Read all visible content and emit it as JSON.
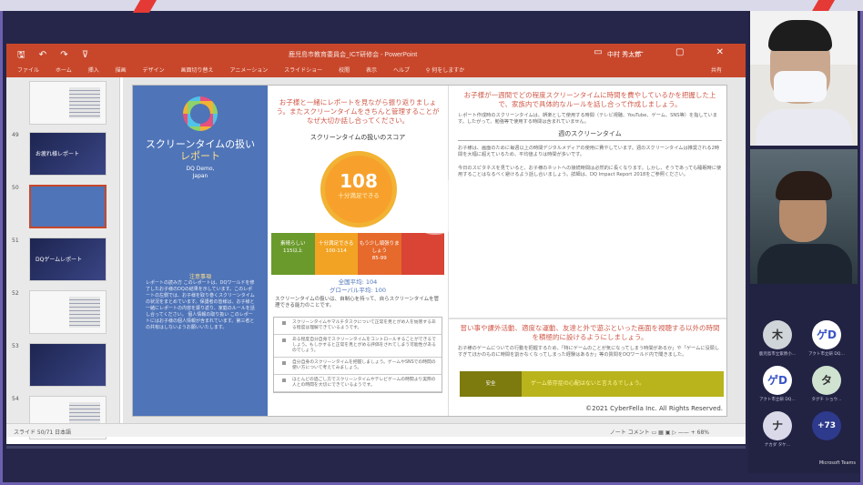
{
  "window": {
    "title": "鹿児島市教育委員会_ICT研修会 - PowerPoint",
    "user": "中村 秀太郎",
    "quick_access": "🖫 ↶ ↷ ⊽",
    "controls": "▭ — ▢ ✕",
    "ribbon_tabs": [
      "ファイル",
      "ホーム",
      "挿入",
      "描画",
      "デザイン",
      "画面切り替え",
      "アニメーション",
      "スライドショー",
      "校閲",
      "表示",
      "ヘルプ"
    ],
    "tell_me": "何をしますか",
    "share": "共有"
  },
  "thumbnails": [
    {
      "num": "",
      "label": ""
    },
    {
      "num": "49",
      "label": "お疲れ様レポート"
    },
    {
      "num": "50",
      "label": ""
    },
    {
      "num": "51",
      "label": "DQゲームレポート"
    },
    {
      "num": "52",
      "label": ""
    },
    {
      "num": "53",
      "label": ""
    },
    {
      "num": "54",
      "label": ""
    }
  ],
  "slide": {
    "left_title_1": "スクリーンタイムの扱い",
    "left_title_2": "レポート",
    "left_sub_1": "DQ Demo,",
    "left_sub_2": "Japan",
    "notes_heading": "注意事項",
    "notes_text": "レポートの読み方\nこのレポートは、DQワールドを修了したお子様のDQの結果を示しています。このレポートの左側では、お子様を取り巻くスクリーンタイムの状況をまとめています。保護者の皆様は、お子様と一緒にレポートの内容を振り返り、家庭のルールを話し合ってください。\n個人情報の取り扱い\nこのレポートにはお子様の個人情報が含まれています。第三者との共有はしないようお願いいたします。",
    "mid_heading": "お子様と一緒にレポートを見ながら振り返りましょう。またスクリーンタイムをきちんと管理することがなぜ大切か話し合ってください。",
    "mid_subheading": "スクリーンタイムの扱いのスコア",
    "score": "108",
    "score_caption": "十分満足できる",
    "scale": [
      {
        "label": "素晴らしい",
        "range": "115以上",
        "color": "#6a9a2b"
      },
      {
        "label": "十分満足できる",
        "range": "100-114",
        "color": "#f2a323"
      },
      {
        "label": "もう少し頑張りましょう",
        "range": "85-99",
        "color": "#e66a2c"
      },
      {
        "label": "",
        "range": "",
        "color": "#d94435"
      }
    ],
    "avg_1": "全国平均: 104",
    "avg_2": "グローバル平均: 100",
    "mid_text": "スクリーンタイムの扱いは、自制心を持って、自らスクリーンタイムを管理できる能力のことです。",
    "table_rows": [
      "スクリーンタイムやマルチタスクについて正常を見とがめ人を妨害するある程度は理解できているようです。",
      "ある程度自分自身でスクリーンタイムをコントロールすることができるでしょう。もしかすると正常を見とがめる評価をされてしまう可能性があるのでしょう。",
      "自分自身のスクリーンタイムを把握しましょう。ゲームやSNSでの時間の使い方について考えてみましょう。",
      "ほとんどの過ごし方でスクリーンタイムやテレビゲームの時間より実際の人との時間を大切にできているようです。"
    ],
    "right_heading": "お子様が一週間でどの程度スクリーンタイムに時間を費やしているかを把握した上で、家族内で具体的なルールを話し合って作成しましょう。",
    "right_text_1": "レポート作成時のスクリーンタイムは、娯楽として使用する時間（テレビ視聴、YouTube、ゲーム、SNS等）を指しています。したがって、勉強等で使用する時間は含まれていません。",
    "right_subheading": "週のスクリーンタイム",
    "right_text_2": "お子様は、画面のために毎週以上の時間デジタルメディアの使用に費やしています。週のスクリーンタイムは推奨される2時間を大幅に超えているため、平均値よりは時間が多いです。",
    "right_text_3": "今日のスピタネスを見ていると、お子様のネットへの接続時間は必然的に長くなります。しかし、そうであっても睡眠時に使用することはなるべく避けるよう話し合いましょう。詳細は、DQ Impact Report 2018をご参照ください。",
    "right_heading_2": "習い事や課外活動、適度な運動、友達と外で遊ぶといった画面を視聴する以外の時間を積極的に設けるようにしましょう。",
    "right_text_4": "お子様のゲームについての行動を把握するため、「特にゲームのことが気になってしまう時間があるか」や「ゲームに没頭しすぎてほかのものに時間を割かなくなってしまった経験はあるか」等の質問をDQワールド内で聞きました。",
    "olive_a": "安全",
    "olive_b": "ゲーム依存症の心配はないと言えるでしょう。",
    "copyright": "©2021 CyberFella Inc. All Rights Reserved."
  },
  "status_bar": {
    "left": "スライド 50/71   日本語",
    "right": "ノート   コメント    ▭  ▦  ▣  ▷   —— + 68%"
  },
  "participants": [
    {
      "initial": "木",
      "name": "鹿児島市立紫原小…",
      "bg": "#cfd5d9",
      "fg": "#333333"
    },
    {
      "initial": "ゲD",
      "name": "アクト市立研 DQ…",
      "bg": "#ffffff",
      "fg": "#3a54c8"
    },
    {
      "initial": "ゲD",
      "name": "アクト市立研 DQ…",
      "bg": "#ffffff",
      "fg": "#3a54c8"
    },
    {
      "initial": "タ",
      "name": "タグチ ショウ…",
      "bg": "#cfe3d0",
      "fg": "#333333"
    },
    {
      "initial": "ナ",
      "name": "ナカダ タケ…",
      "bg": "#d9d9e9",
      "fg": "#333333"
    },
    {
      "initial": "+73",
      "name": "",
      "bg": "#2e3a8c",
      "fg": "#ffffff"
    }
  ],
  "brand": "Microsoft Teams"
}
